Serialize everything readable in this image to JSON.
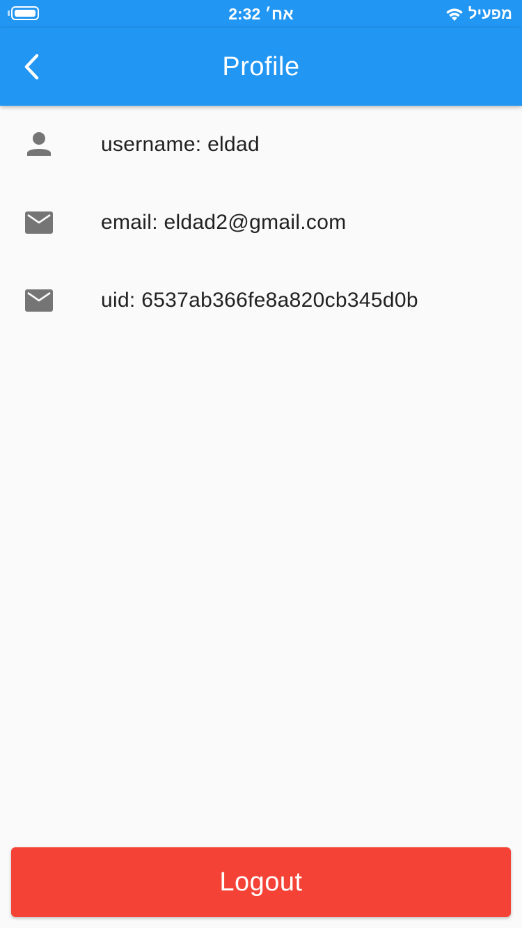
{
  "status_bar": {
    "time": "2:32 אח׳",
    "carrier": "מפעיל",
    "icons": [
      "battery-icon",
      "wifi-icon"
    ]
  },
  "app_bar": {
    "title": "Profile",
    "back_icon": "chevron-left-icon"
  },
  "profile_items": [
    {
      "icon": "person-icon",
      "text": "username: eldad"
    },
    {
      "icon": "mail-icon",
      "text": "email: eldad2@gmail.com"
    },
    {
      "icon": "mail-icon",
      "text": "uid: 6537ab366fe8a820cb345d0b"
    }
  ],
  "logout": {
    "label": "Logout"
  },
  "colors": {
    "primary": "#2196f3",
    "logout": "#f44336",
    "background": "#fafafa",
    "icon": "#757575",
    "text": "#212121"
  }
}
